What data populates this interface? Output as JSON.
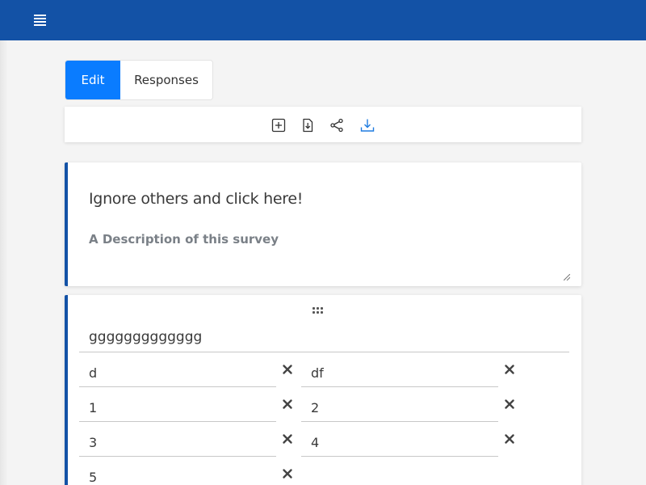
{
  "app": {
    "theme_color": "#1352a6",
    "accent_color": "#0a7cff"
  },
  "topbar": {
    "menu_icon": "hamburger-menu-icon"
  },
  "tabs": [
    {
      "label": "Edit",
      "active": true
    },
    {
      "label": "Responses",
      "active": false
    }
  ],
  "toolbar": {
    "tools": [
      {
        "icon": "add-question-icon"
      },
      {
        "icon": "import-file-icon"
      },
      {
        "icon": "share-icon"
      },
      {
        "icon": "download-icon"
      }
    ]
  },
  "survey": {
    "title": "Ignore others and click here!",
    "description": "A Description of this survey"
  },
  "question": {
    "title": "ggggggggggggg",
    "options": [
      {
        "label": "d"
      },
      {
        "label": "df"
      },
      {
        "label": "1"
      },
      {
        "label": "2"
      },
      {
        "label": "3"
      },
      {
        "label": "4"
      },
      {
        "label": "5"
      }
    ],
    "remove_icon": "close-icon",
    "drag_icon": "drag-handle-icon"
  }
}
